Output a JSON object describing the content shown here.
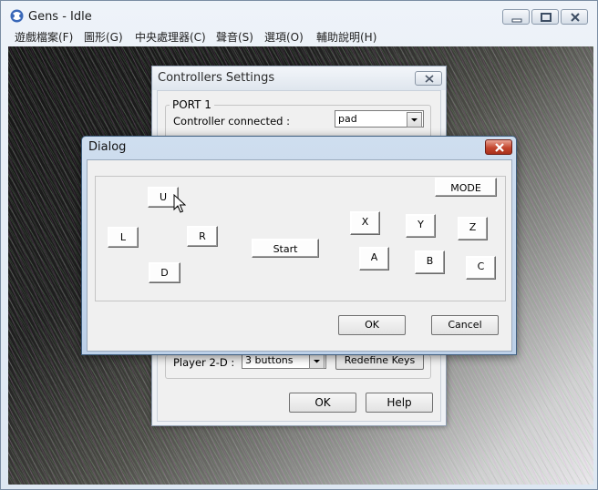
{
  "app": {
    "title": "Gens - Idle",
    "menu": [
      "遊戲檔案(F)",
      "圖形(G)",
      "中央處理器(C)",
      "聲音(S)",
      "選項(O)",
      "輔助說明(H)"
    ]
  },
  "controllers_window": {
    "title": "Controllers Settings",
    "port1": {
      "legend": "PORT 1",
      "label": "Controller connected :",
      "value": "pad"
    },
    "player": {
      "label": "Player 2-D :",
      "value": "3 buttons",
      "redefine_label": "Redefine Keys"
    },
    "ok_label": "OK",
    "help_label": "Help"
  },
  "dialog": {
    "title": "Dialog",
    "keys": {
      "u": "U",
      "l": "L",
      "r": "R",
      "d": "D",
      "start": "Start",
      "mode": "MODE",
      "x": "X",
      "y": "Y",
      "z": "Z",
      "a": "A",
      "b": "B",
      "c": "C"
    },
    "ok_label": "OK",
    "cancel_label": "Cancel"
  },
  "colors": {
    "dialog_close": "#c4462e",
    "dialog_frame": "#bcd0e8"
  }
}
